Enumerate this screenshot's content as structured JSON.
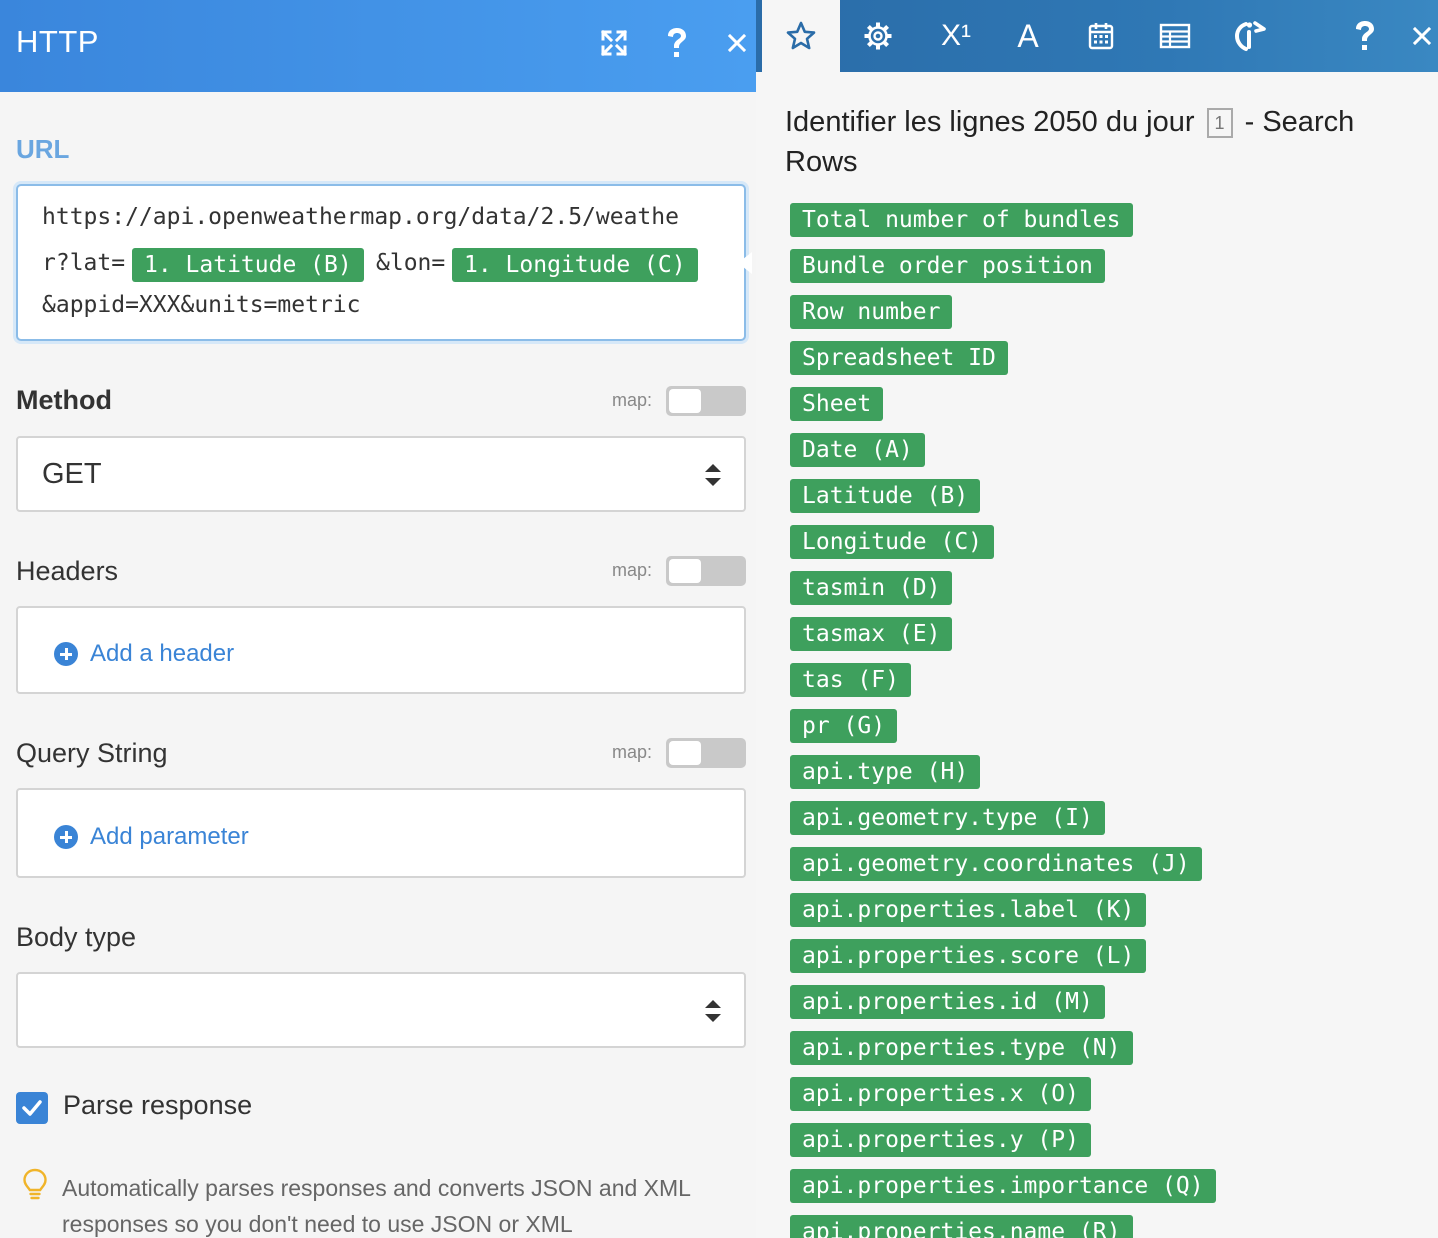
{
  "left_panel": {
    "title": "HTTP",
    "icons": {
      "expand": "expand-icon",
      "help": "question-icon",
      "close": "close-icon"
    },
    "url": {
      "label": "URL",
      "line1": "https://api.openweathermap.org/data/2.5/weathe",
      "line2_prefix": "r?lat=",
      "lat_pill": "1. Latitude (B)",
      "line2_mid": "&lon=",
      "lon_pill": "1. Longitude (C)",
      "line3": "&appid=XXX&units=metric"
    },
    "method": {
      "label": "Method",
      "map_label": "map:",
      "value": "GET"
    },
    "headers": {
      "label": "Headers",
      "map_label": "map:",
      "add_label": "Add a header"
    },
    "query_string": {
      "label": "Query String",
      "map_label": "map:",
      "add_label": "Add parameter"
    },
    "body_type": {
      "label": "Body type",
      "value": ""
    },
    "parse_response": {
      "label": "Parse response",
      "checked": true,
      "help": "Automatically parses responses and converts JSON and XML responses so you don't need to use JSON or XML"
    }
  },
  "right_panel": {
    "toolbar": {
      "superscript_label": "X¹",
      "text_label": "A",
      "icons": [
        "star-icon",
        "gear-icon",
        "superscript-icon",
        "text-icon",
        "calendar-icon",
        "table-icon",
        "mapper-icon",
        "question-icon",
        "close-icon"
      ]
    },
    "module": {
      "title_prefix": "Identifier les lignes 2050 du jour",
      "badge": "1",
      "title_suffix": "- Search Rows"
    },
    "items": [
      "Total number of bundles",
      "Bundle order position",
      "Row number",
      "Spreadsheet ID",
      "Sheet",
      "Date (A)",
      "Latitude (B)",
      "Longitude (C)",
      "tasmin (D)",
      "tasmax (E)",
      "tas (F)",
      "pr (G)",
      "api.type (H)",
      "api.geometry.type (I)",
      "api.geometry.coordinates (J)",
      "api.properties.label (K)",
      "api.properties.score (L)",
      "api.properties.id (M)",
      "api.properties.type (N)",
      "api.properties.x (O)",
      "api.properties.y (P)",
      "api.properties.importance (Q)",
      "api.properties.name (R)"
    ]
  },
  "colors": {
    "header_blue": "#3a86dc",
    "toolbar_blue": "#2a6ca8",
    "pill_green": "#3ea05d",
    "link_blue": "#3a84d6",
    "url_label_blue": "#6aa6e0"
  }
}
